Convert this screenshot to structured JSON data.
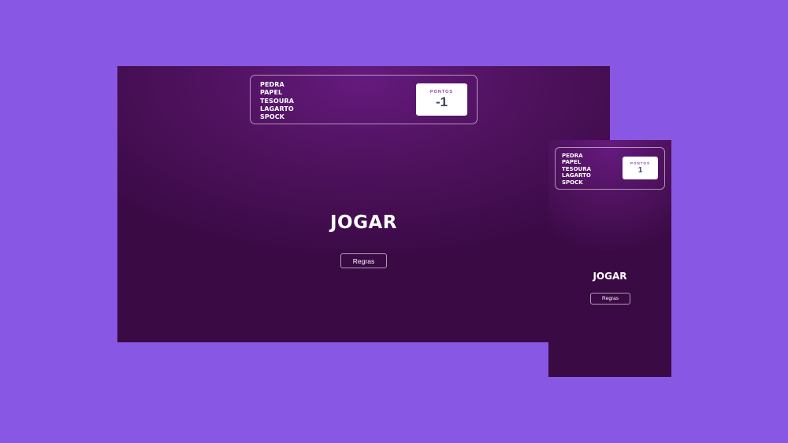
{
  "desktop": {
    "title_lines": [
      "PEDRA",
      "PAPEL",
      "TESOURA",
      "LAGARTO",
      "SPOCK"
    ],
    "score_label": "PONTOS",
    "score_value": "-1",
    "play_heading": "JOGAR",
    "rules_label": "Regras"
  },
  "mobile": {
    "title_lines": [
      "PEDRA",
      "PAPEL",
      "TESOURA",
      "LAGARTO",
      "SPOCK"
    ],
    "score_label": "PONTOS",
    "score_value": "1",
    "play_heading": "JOGAR",
    "rules_label": "Regras"
  },
  "colors": {
    "page_background": "#8857e3",
    "panel_gradient_center": "#651a7e",
    "panel_gradient_edge": "#3a0a45",
    "score_label": "#8b3fc2",
    "score_value": "#3b4262"
  }
}
